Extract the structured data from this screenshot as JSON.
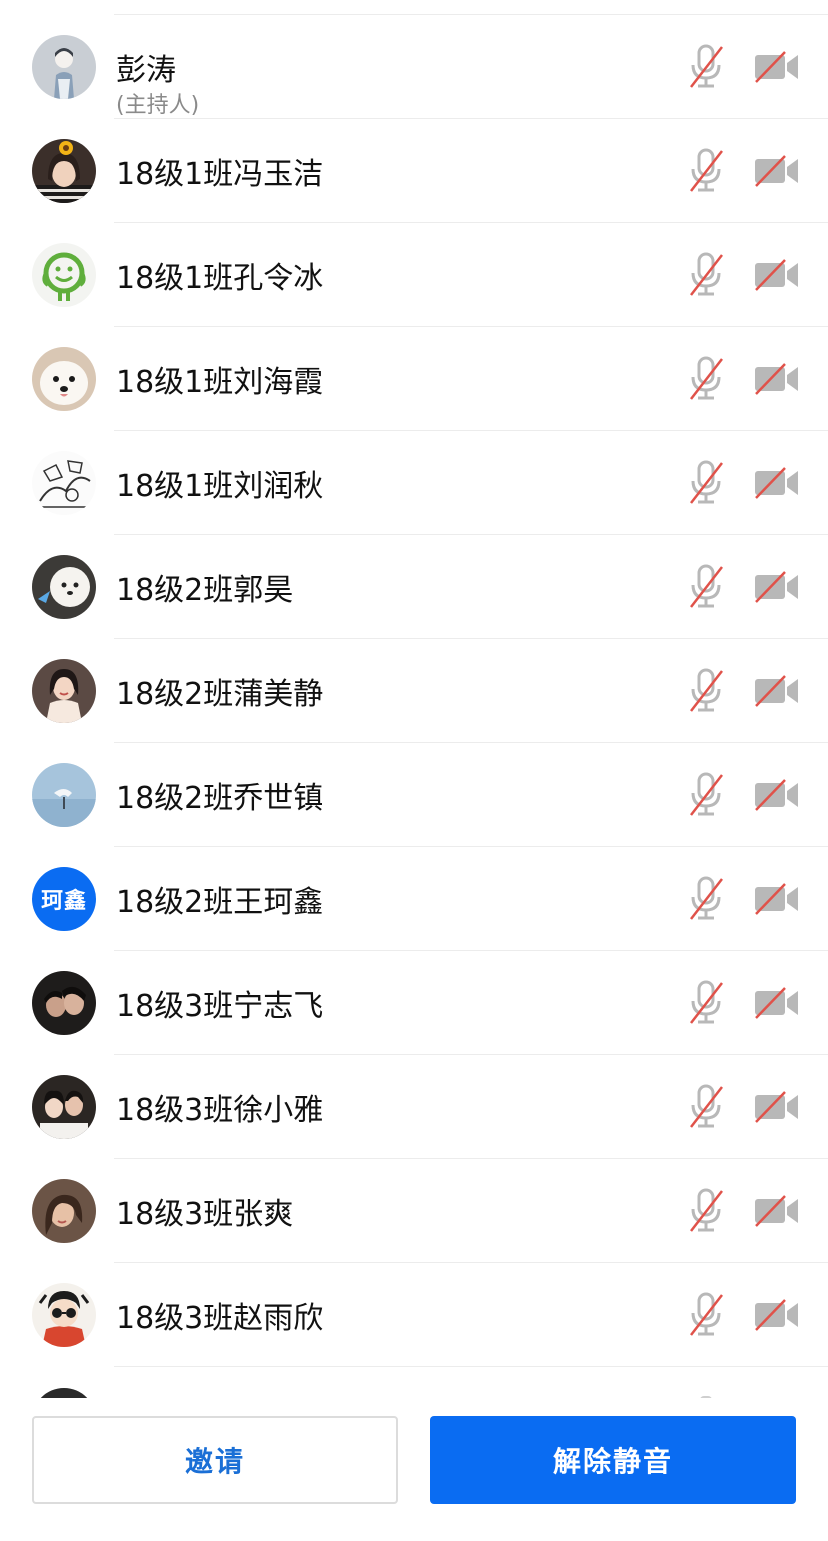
{
  "participants": [
    {
      "name": "彭涛",
      "role": "(主持人)",
      "avatar": "avatar-sketch-person",
      "mic": "mic-muted-icon",
      "camera": "camera-off-icon"
    },
    {
      "name": "18级1班冯玉洁",
      "avatar": "avatar-photo-sunflower-girl",
      "mic": "mic-muted-icon",
      "camera": "camera-off-icon"
    },
    {
      "name": "18级1班孔令冰",
      "avatar": "avatar-smiley-face",
      "mic": "mic-muted-icon",
      "camera": "camera-off-icon"
    },
    {
      "name": "18级1班刘海霞",
      "avatar": "avatar-photo-samoyed-dog",
      "mic": "mic-muted-icon",
      "camera": "camera-off-icon"
    },
    {
      "name": "18级1班刘润秋",
      "avatar": "avatar-comic-sketch",
      "mic": "mic-muted-icon",
      "camera": "camera-off-icon"
    },
    {
      "name": "18级2班郭昊",
      "avatar": "avatar-photo-white-poodle",
      "mic": "mic-muted-icon",
      "camera": "camera-off-icon"
    },
    {
      "name": "18级2班蒲美静",
      "avatar": "avatar-illustration-girl",
      "mic": "mic-muted-icon",
      "camera": "camera-off-icon"
    },
    {
      "name": "18级2班乔世镇",
      "avatar": "avatar-photo-seabird",
      "mic": "mic-muted-icon",
      "camera": "camera-off-icon"
    },
    {
      "name": "18级2班王珂鑫",
      "avatar_text": "珂鑫",
      "avatar": "avatar-initials",
      "mic": "mic-muted-icon",
      "camera": "camera-off-icon"
    },
    {
      "name": "18级3班宁志飞",
      "avatar": "avatar-photo-couple-dark",
      "mic": "mic-muted-icon",
      "camera": "camera-off-icon"
    },
    {
      "name": "18级3班徐小雅",
      "avatar": "avatar-photo-couple",
      "mic": "mic-muted-icon",
      "camera": "camera-off-icon"
    },
    {
      "name": "18级3班张爽",
      "avatar": "avatar-photo-woman",
      "mic": "mic-muted-icon",
      "camera": "camera-off-icon"
    },
    {
      "name": "18级3班赵雨欣",
      "avatar": "avatar-cartoon-glasses",
      "mic": "mic-muted-icon",
      "camera": "camera-off-icon"
    }
  ],
  "actions": {
    "invite_label": "邀请",
    "unmute_label": "解除静音"
  },
  "colors": {
    "accent": "#0a6cf2",
    "invite_text": "#1a6fd6",
    "muted_slash": "#e0524a",
    "icon_gray": "#b8b8b8"
  }
}
